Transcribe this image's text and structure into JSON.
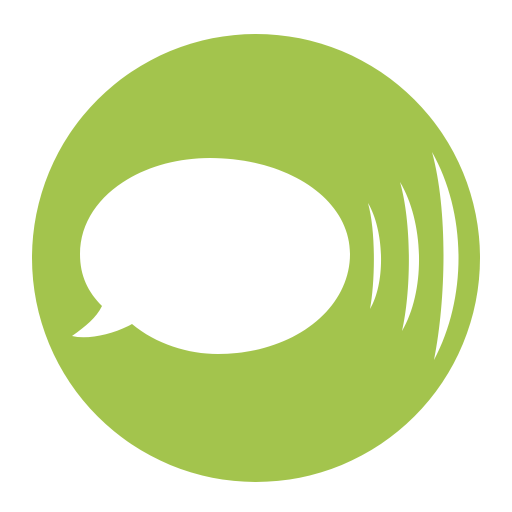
{
  "app_icon": {
    "name": "speech-bubble-sound-icon",
    "colors": {
      "circle": "#a3c44d",
      "glyph": "#ffffff",
      "background": "#ffffff"
    },
    "elements": {
      "circle": "circle-background",
      "bubble": "speech-bubble-icon",
      "waves": [
        "sound-wave-small",
        "sound-wave-medium",
        "sound-wave-large"
      ]
    }
  }
}
